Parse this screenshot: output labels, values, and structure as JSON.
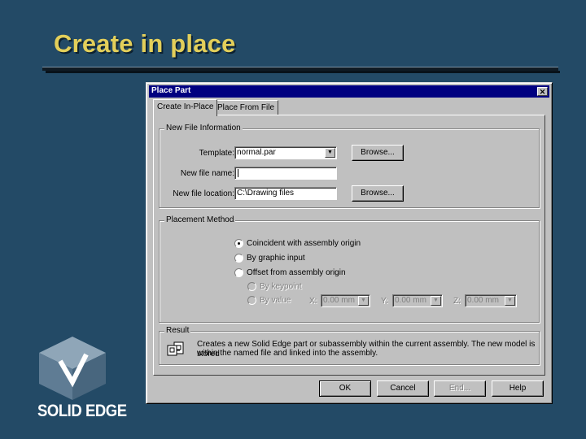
{
  "slide": {
    "title": "Create in place"
  },
  "dialog": {
    "title": "Place Part",
    "close_glyph": "✕",
    "tabs": [
      {
        "label": "Create In-Place",
        "active": true
      },
      {
        "label": "Place From File",
        "active": false
      }
    ],
    "new_file_info": {
      "group_label": "New File Information",
      "template_label": "Template:",
      "template_value": "normal.par",
      "new_file_name_label": "New file name:",
      "new_file_name_value": "",
      "location_label": "New file location:",
      "location_value": "C:\\Drawing files",
      "browse_label": "Browse...",
      "browse_label_2": "Browse..."
    },
    "placement": {
      "group_label": "Placement Method",
      "options": [
        {
          "label": "Coincident with assembly origin",
          "checked": true,
          "enabled": true
        },
        {
          "label": "By graphic input",
          "checked": false,
          "enabled": true
        },
        {
          "label": "Offset from assembly origin",
          "checked": false,
          "enabled": true
        },
        {
          "label": "By keypoint",
          "checked": false,
          "enabled": false
        },
        {
          "label": "By value",
          "checked": false,
          "enabled": false
        }
      ],
      "x_label": "X:",
      "y_label": "Y:",
      "z_label": "Z:",
      "x_value": "0.00 mm",
      "y_value": "0.00 mm",
      "z_value": "0.00 mm"
    },
    "result": {
      "group_label": "Result",
      "line1": "Creates a new Solid Edge part or subassembly within the current assembly.  The new model is stored",
      "line2": "within the named file and linked into the assembly."
    },
    "buttons": {
      "ok": "OK",
      "cancel": "Cancel",
      "end": "End...",
      "help": "Help"
    }
  },
  "logo": {
    "text": "SOLID EDGE"
  },
  "colors": {
    "background": "#234a66",
    "title": "#e3cf5a",
    "titlebar": "#000080",
    "dialog_face": "#c0c0c0"
  }
}
